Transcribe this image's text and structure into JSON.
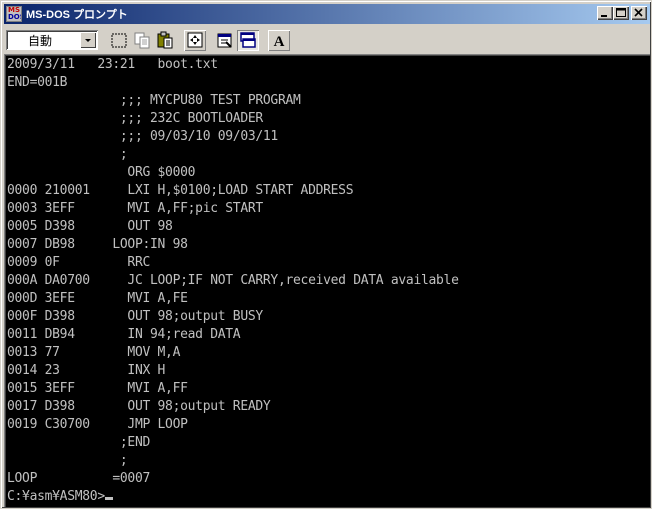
{
  "window": {
    "title": "MS-DOS プロンプト",
    "app_icon": "ms-dos-icon",
    "controls": [
      "minimize-icon",
      "maximize-icon",
      "close-icon"
    ]
  },
  "toolbar": {
    "font_size_value": "自動",
    "icons": [
      "mark-icon",
      "copy-icon",
      "paste-icon",
      "fullscreen-icon",
      "properties-icon",
      "background-icon",
      "font-icon"
    ],
    "font_button_label": "A"
  },
  "console": {
    "lines": [
      "2009/3/11   23:21   boot.txt",
      "END=001B",
      "               ;;; MYCPU80 TEST PROGRAM",
      "               ;;; 232C BOOTLOADER",
      "               ;;; 09/03/10 09/03/11",
      "               ;",
      "                ORG $0000",
      "0000 210001     LXI H,$0100;LOAD START ADDRESS",
      "0003 3EFF       MVI A,FF;pic START",
      "0005 D398       OUT 98",
      "0007 DB98     LOOP:IN 98",
      "0009 0F         RRC",
      "000A DA0700     JC LOOP;IF NOT CARRY,received DATA available",
      "000D 3EFE       MVI A,FE",
      "000F D398       OUT 98;output BUSY",
      "0011 DB94       IN 94;read DATA",
      "0013 77         MOV M,A",
      "0014 23         INX H",
      "0015 3EFF       MVI A,FF",
      "0017 D398       OUT 98;output READY",
      "0019 C30700     JMP LOOP",
      "               ;END",
      "               ;",
      "LOOP          =0007"
    ],
    "prompt": "C:¥asm¥ASM80>"
  },
  "colors": {
    "console_bg": "#000000",
    "console_fg": "#c0c0c0",
    "titlebar_start": "#0a246a",
    "titlebar_end": "#a6caf0"
  }
}
